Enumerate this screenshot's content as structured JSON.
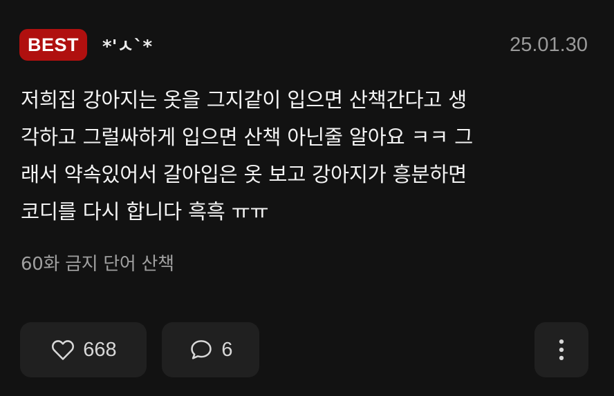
{
  "comment": {
    "badge": "BEST",
    "author": "*'ㅅ`*",
    "date": "25.01.30",
    "lines": [
      "저희집 강아지는 옷을 그지같이 입으면 산책간다고 생",
      "각하고 그럴싸하게 입으면 산책 아닌줄 알아요 ㅋㅋ 그",
      "래서 약속있어서 갈아입은 옷 보고 강아지가 흥분하면",
      "코디를 다시 합니다 흑흑 ㅠㅠ"
    ],
    "tag": "60화 금지 단어 산책"
  },
  "actions": {
    "like_count": "668",
    "reply_count": "6",
    "icons": {
      "like": "heart-outline-icon",
      "reply": "speech-bubble-icon",
      "more": "vertical-dots-icon"
    }
  },
  "colors": {
    "background": "#121212",
    "badge": "#b0100f",
    "button": "#202020",
    "muted_text": "#9a9a9a"
  }
}
